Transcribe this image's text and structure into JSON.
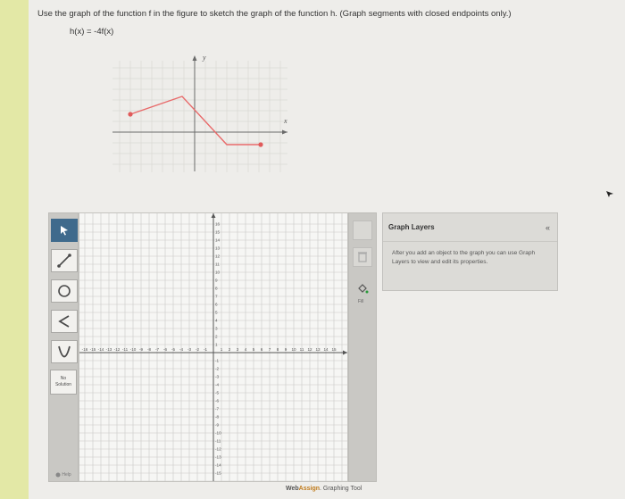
{
  "question": {
    "text": "Use the graph of the function f in the figure to sketch the graph of the function h. (Graph segments with closed endpoints only.)",
    "formula": "h(x) = -4f(x)"
  },
  "given_graph": {
    "x_label": "x",
    "y_label": "y"
  },
  "tools": [
    {
      "name": "pointer-tool",
      "icon": "arrow-icon"
    },
    {
      "name": "line-segment-tool",
      "icon": "line-segment-icon"
    },
    {
      "name": "circle-tool",
      "icon": "circle-icon"
    },
    {
      "name": "angle-tool",
      "icon": "angle-icon"
    },
    {
      "name": "parabola-tool",
      "icon": "parabola-icon"
    },
    {
      "name": "point-tool",
      "icon": "point-icon"
    }
  ],
  "no_solution": {
    "line1": "No",
    "line2": "Solution"
  },
  "help_label": "Help",
  "fill_label": "Fill",
  "graph_axis": {
    "x_ticks_left": [
      "-16",
      "-15",
      "-14",
      "-13",
      "-12",
      "-11",
      "-10",
      "-9",
      "-8",
      "-7",
      "-6",
      "-5",
      "-4",
      "-3",
      "-2",
      "-1"
    ],
    "x_ticks_right": [
      "1",
      "2",
      "3",
      "4",
      "5",
      "6",
      "7",
      "8",
      "9",
      "10",
      "11",
      "12",
      "13",
      "14",
      "15"
    ],
    "y_ticks_up": [
      "16",
      "15",
      "14",
      "13",
      "12",
      "11",
      "10",
      "9",
      "8",
      "7",
      "6",
      "5",
      "4",
      "3",
      "2",
      "1"
    ],
    "y_ticks_down": [
      "-1",
      "-2",
      "-3",
      "-4",
      "-5",
      "-6",
      "-7",
      "-8",
      "-9",
      "-10",
      "-11",
      "-12",
      "-13",
      "-14",
      "-15"
    ]
  },
  "branding": {
    "web": "Web",
    "assign": "Assign",
    "suffix": ". Graphing Tool"
  },
  "layers": {
    "title": "Graph Layers",
    "collapse": "«",
    "body": "After you add an object to the graph you can use Graph Layers to view and edit its properties."
  },
  "colors": {
    "accent_point": "#e05a5a",
    "accent_line": "#e86a6a",
    "active_tool": "#3f6a8c"
  }
}
